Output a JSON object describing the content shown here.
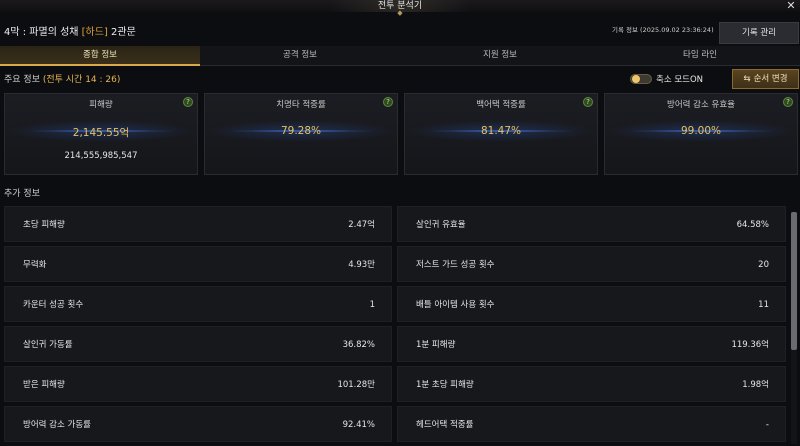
{
  "window": {
    "title": "전투 분석기",
    "close": "✕"
  },
  "header": {
    "stage_prefix": "4막 : 파멸의 성채 ",
    "difficulty": "[하드]",
    "stage_suffix": " 2관문",
    "record_info": "기록 정보 (2025.09.02 23:36:24)",
    "record_manage": "기록 관리"
  },
  "tabs": [
    {
      "label": "종합 정보",
      "active": true
    },
    {
      "label": "공격 정보",
      "active": false
    },
    {
      "label": "지원 정보",
      "active": false
    },
    {
      "label": "타임 라인",
      "active": false
    }
  ],
  "main_section": {
    "title_prefix": "주요 정보 ",
    "battle_time": "(전투 시간 14 : 26)",
    "toggle_label": "축소 모드ON",
    "toggle_on": true,
    "order_button": "순서 변경"
  },
  "cards": [
    {
      "label": "피해량",
      "value": "2,145.55억",
      "sub": "214,555,985,547"
    },
    {
      "label": "치명타 적중률",
      "value": "79.28%",
      "sub": ""
    },
    {
      "label": "백어택 적중률",
      "value": "81.47%",
      "sub": ""
    },
    {
      "label": "방어력 감소 유효율",
      "value": "99.00%",
      "sub": ""
    }
  ],
  "extra_section": {
    "title": "추가 정보",
    "rows": [
      {
        "left_label": "초당 피해량",
        "left_value": "2.47억",
        "right_label": "살인귀 유효율",
        "right_value": "64.58%"
      },
      {
        "left_label": "무력화",
        "left_value": "4.93만",
        "right_label": "저스트 가드 성공 횟수",
        "right_value": "20"
      },
      {
        "left_label": "카운터 성공 횟수",
        "left_value": "1",
        "right_label": "배틀 아이템 사용 횟수",
        "right_value": "11"
      },
      {
        "left_label": "살인귀 가동률",
        "left_value": "36.82%",
        "right_label": "1분 피해량",
        "right_value": "119.36억"
      },
      {
        "left_label": "받은 피해량",
        "left_value": "101.28만",
        "right_label": "1분 초당 피해량",
        "right_value": "1.98억"
      },
      {
        "left_label": "방어력 감소 가동률",
        "left_value": "92.41%",
        "right_label": "헤드어택 적중률",
        "right_value": "-"
      }
    ]
  },
  "colors": {
    "accent_gold": "#e9c15e",
    "tab_active_underline": "#d8aa49",
    "help_green": "#5d8a3a"
  }
}
